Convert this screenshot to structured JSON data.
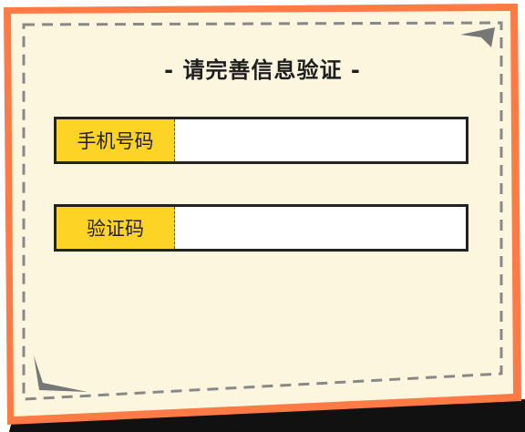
{
  "dialog": {
    "title": "- 请完善信息验证 -",
    "fields": [
      {
        "label": "手机号码",
        "value": "",
        "placeholder": ""
      },
      {
        "label": "验证码",
        "value": "",
        "placeholder": ""
      }
    ]
  },
  "colors": {
    "outer_border": "#ff7a45",
    "panel": "#fdf6df",
    "dash": "#888888",
    "label_bg": "#fdd425",
    "shadow": "#111111"
  }
}
